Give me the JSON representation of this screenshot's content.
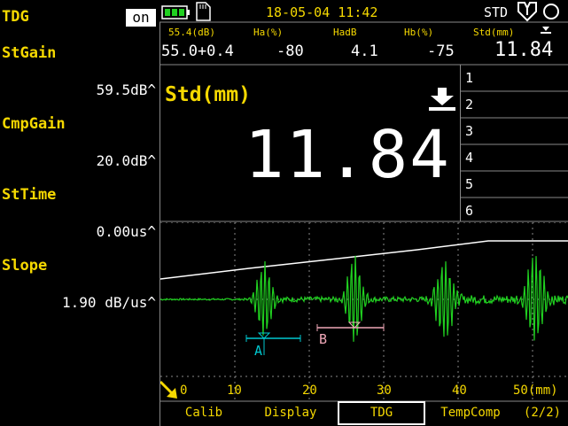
{
  "left_panel": {
    "mode_label": "TDG",
    "mode_toggle": "on",
    "params": [
      {
        "label": "StGain",
        "value": "59.5dB^"
      },
      {
        "label": "CmpGain",
        "value": "20.0dB^"
      },
      {
        "label": "StTime",
        "value": "0.00us^"
      },
      {
        "label": "Slope",
        "value": "1.90 dB/us^"
      }
    ]
  },
  "status_bar": {
    "battery_icon": "battery-icon",
    "sd_icon": "sd-card-icon",
    "datetime": "18-05-04 11:42",
    "mode": "STD",
    "probe_icon": "probe-icon",
    "circle_icon": "circle-icon"
  },
  "measurements": {
    "headers": [
      "55.4(dB)",
      "Ha(%)",
      "HadB",
      "Hb(%)",
      "Std(mm)"
    ],
    "values": [
      "55.0+0.4",
      "-80",
      "4.1",
      "-75",
      "11.84"
    ]
  },
  "main_readout": {
    "label": "Std(mm)",
    "value": "11.84",
    "slots": [
      "1",
      "2",
      "3",
      "4",
      "5",
      "6"
    ]
  },
  "plot": {
    "x_ticks": [
      "0",
      "10",
      "20",
      "30",
      "40",
      "50(mm)"
    ],
    "gate_a_label": "A",
    "gate_b_label": "B",
    "gate_a_color": "#00c8d0",
    "gate_b_color": "#f0a8b8",
    "signal_color": "#20d020"
  },
  "menu": {
    "items": [
      "Calib",
      "Display",
      "TDG",
      "TempComp"
    ],
    "page": "(2/2)",
    "selected": "TDG"
  }
}
